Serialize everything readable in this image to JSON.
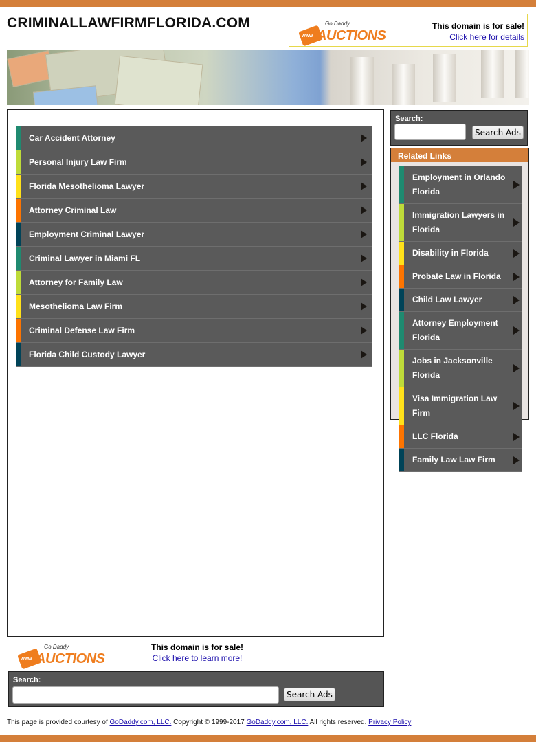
{
  "site": {
    "title": "CRIMINALLAWFIRMFLORIDA.COM"
  },
  "header_sale": {
    "logo_brand": "Go Daddy",
    "logo_word": "AUCTIONS",
    "logo_www": "www",
    "headline": "This domain is for sale!",
    "link": "Click here for details"
  },
  "colors": {
    "accent": "#d47f3a",
    "panel": "#5a5a5a",
    "stripes": [
      "#1f8a70",
      "#bedb39",
      "#ffe11a",
      "#fd7400",
      "#004358"
    ]
  },
  "main_links": [
    {
      "label": "Car Accident Attorney",
      "color": "#1f8a70"
    },
    {
      "label": "Personal Injury Law Firm",
      "color": "#bedb39"
    },
    {
      "label": "Florida Mesothelioma Lawyer",
      "color": "#ffe11a"
    },
    {
      "label": "Attorney Criminal Law",
      "color": "#fd7400"
    },
    {
      "label": "Employment Criminal Lawyer",
      "color": "#004358"
    },
    {
      "label": "Criminal Lawyer in Miami FL",
      "color": "#1f8a70"
    },
    {
      "label": "Attorney for Family Law",
      "color": "#bedb39"
    },
    {
      "label": "Mesothelioma Law Firm",
      "color": "#ffe11a"
    },
    {
      "label": "Criminal Defense Law Firm",
      "color": "#fd7400"
    },
    {
      "label": "Florida Child Custody Lawyer",
      "color": "#004358"
    }
  ],
  "side_search": {
    "label": "Search:",
    "value": "",
    "button": "Search Ads"
  },
  "related": {
    "title": "Related Links",
    "items": [
      {
        "label": "Employment in Orlando Florida",
        "color": "#1f8a70"
      },
      {
        "label": "Immigration Lawyers in Florida",
        "color": "#bedb39"
      },
      {
        "label": "Disability in Florida",
        "color": "#ffe11a"
      },
      {
        "label": "Probate Law in Florida",
        "color": "#fd7400"
      },
      {
        "label": "Child Law Lawyer",
        "color": "#004358"
      },
      {
        "label": "Attorney Employment Florida",
        "color": "#1f8a70"
      },
      {
        "label": "Jobs in Jacksonville Florida",
        "color": "#bedb39"
      },
      {
        "label": "Visa Immigration Law Firm",
        "color": "#ffe11a"
      },
      {
        "label": "LLC Florida",
        "color": "#fd7400"
      },
      {
        "label": "Family Law Law Firm",
        "color": "#004358"
      }
    ]
  },
  "bottom_sale": {
    "headline": "This domain is for sale!",
    "link": "Click here to learn more!"
  },
  "bottom_search": {
    "label": "Search:",
    "value": "",
    "button": "Search Ads"
  },
  "footer": {
    "text1": "This page is provided courtesy of ",
    "link1": "GoDaddy.com, LLC.",
    "text2": " Copyright © 1999-2017 ",
    "link2": "GoDaddy.com, LLC.",
    "text3": " All rights reserved. ",
    "link3": "Privacy Policy"
  }
}
